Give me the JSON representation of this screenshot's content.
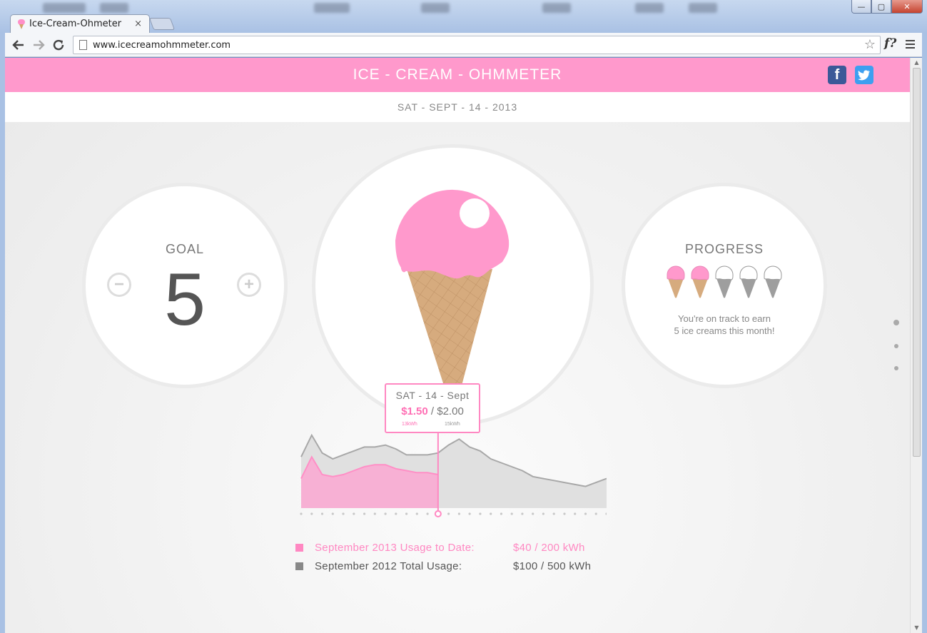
{
  "browser": {
    "tab_title": "Ice-Cream-Ohmeter",
    "tab_close": "×",
    "url": "www.icecreamohmmeter.com",
    "window_minimize": "—",
    "window_maximize": "▢",
    "window_close": "✕",
    "extension_label": "f?"
  },
  "header": {
    "title": "ICE - CREAM - OHMMETER",
    "facebook_label": "f",
    "twitter_label": "t"
  },
  "date": "SAT - SEPT - 14 - 2013",
  "goal": {
    "label": "GOAL",
    "value": "5",
    "minus_label": "−",
    "plus_label": "+"
  },
  "progress": {
    "label": "PROGRESS",
    "earned": 2,
    "total": 5,
    "text_line1": "You're on track to earn",
    "text_line2": "5 ice creams this month!"
  },
  "tooltip": {
    "date": "SAT - 14 - Sept",
    "current_cost": "$1.50",
    "separator": " / ",
    "previous_cost": "$2.00",
    "current_kwh": "13kWh",
    "previous_kwh": "15kWh"
  },
  "legend": {
    "current_label": "September 2013 Usage to Date:",
    "current_value": "$40 / 200 kWh",
    "previous_label": "September 2012 Total Usage:",
    "previous_value": "$100 / 500 kWh"
  },
  "colors": {
    "pink": "#ff99cc",
    "gray": "#999999"
  },
  "chart_data": {
    "type": "area",
    "x": [
      1,
      2,
      3,
      4,
      5,
      6,
      7,
      8,
      9,
      10,
      11,
      12,
      13,
      14,
      15,
      16,
      17,
      18,
      19,
      20,
      21,
      22,
      23,
      24,
      25,
      26,
      27,
      28,
      29,
      30
    ],
    "series": [
      {
        "name": "September 2012 Total Usage",
        "values": [
          26,
          37,
          28,
          25,
          27,
          29,
          31,
          31,
          32,
          30,
          27,
          27,
          27,
          28,
          32,
          35,
          31,
          29,
          25,
          23,
          21,
          19,
          16,
          15,
          14,
          13,
          12,
          11,
          13,
          15
        ]
      },
      {
        "name": "September 2013 Usage to Date",
        "values": [
          15,
          26,
          17,
          16,
          17,
          19,
          21,
          22,
          22,
          20,
          19,
          18,
          18,
          17
        ]
      }
    ],
    "highlight_index": 13
  }
}
